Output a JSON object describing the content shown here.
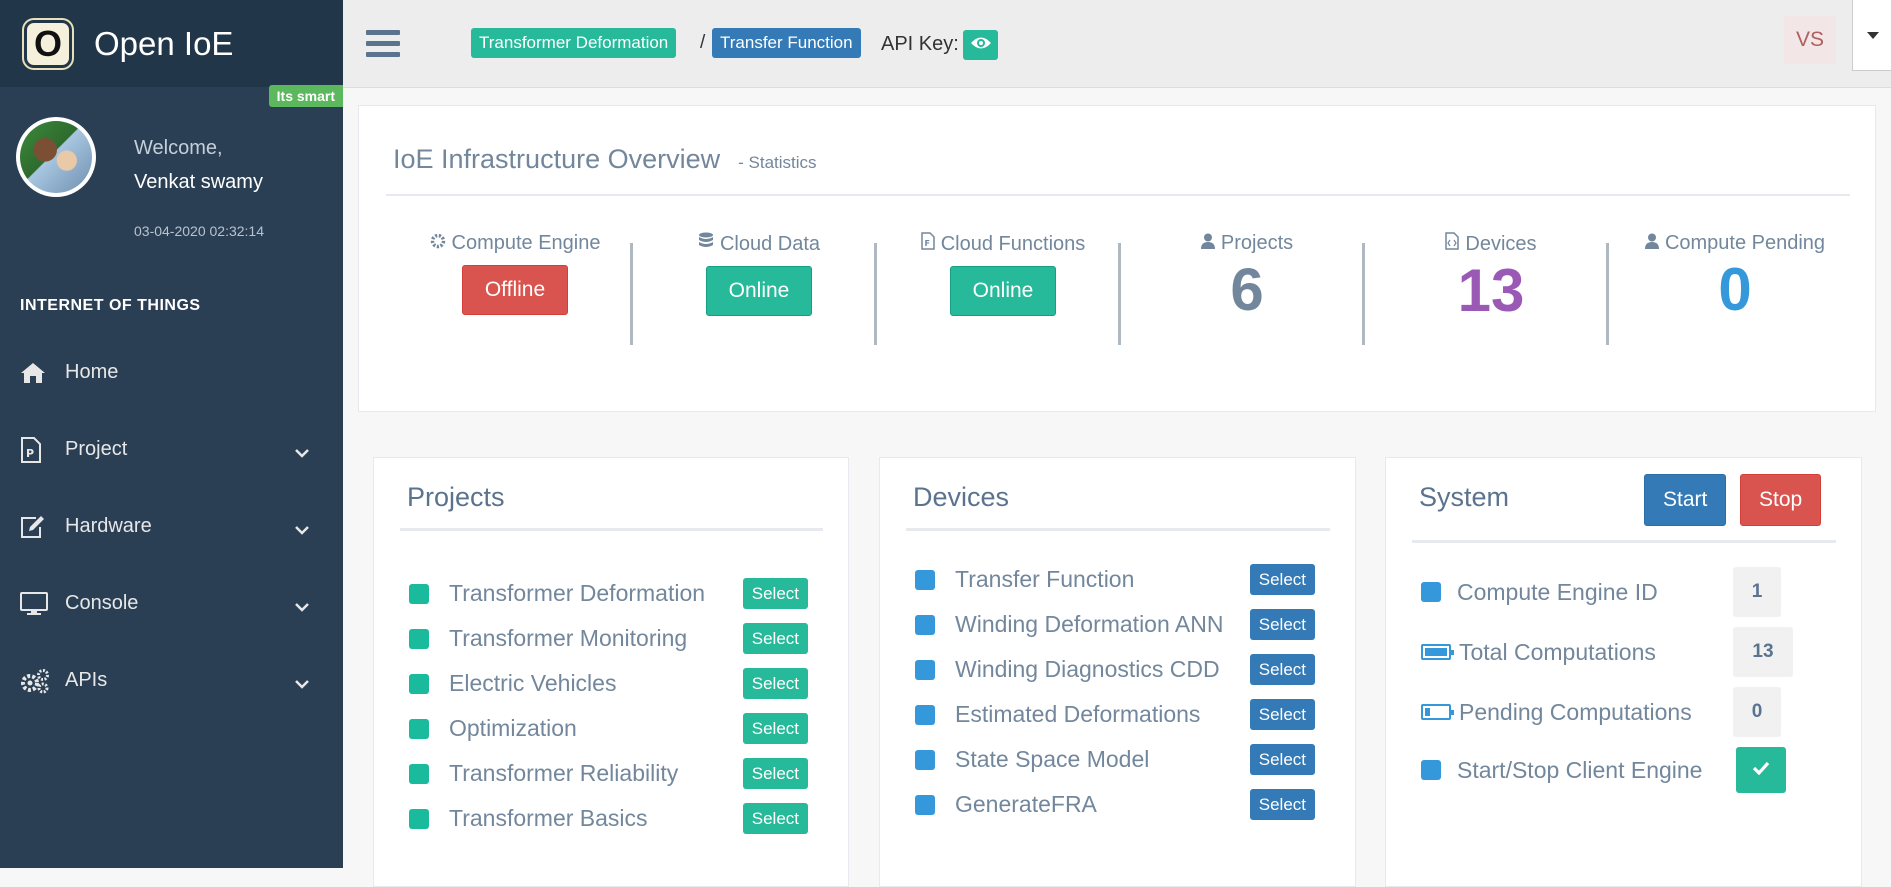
{
  "sidebar": {
    "brand_logo": "O",
    "brand_name": "Open IoE",
    "badge": "Its smart",
    "welcome": "Welcome,",
    "username": "Venkat swamy",
    "timestamp": "03-04-2020 02:32:14",
    "section_title": "INTERNET OF THINGS",
    "items": [
      {
        "label": "Home",
        "icon": "home-icon"
      },
      {
        "label": "Project",
        "icon": "project-icon"
      },
      {
        "label": "Hardware",
        "icon": "edit-icon"
      },
      {
        "label": "Console",
        "icon": "monitor-icon"
      },
      {
        "label": "APIs",
        "icon": "gears-icon"
      }
    ]
  },
  "topnav": {
    "breadcrumb": [
      "Transformer Deformation",
      "Transfer Function"
    ],
    "separator": "/",
    "api_key_label": "API Key:",
    "user_initials": "VS"
  },
  "overview": {
    "title": "IoE Infrastructure Overview",
    "subtitle": "- Statistics",
    "stats": [
      {
        "label": "Compute Engine",
        "status": "Offline",
        "icon": "gear-icon"
      },
      {
        "label": "Cloud Data",
        "status": "Online",
        "icon": "database-icon"
      },
      {
        "label": "Cloud Functions",
        "status": "Online",
        "icon": "file-code-icon"
      },
      {
        "label": "Projects",
        "value": "6",
        "icon": "user-icon"
      },
      {
        "label": "Devices",
        "value": "13",
        "icon": "file-code-icon"
      },
      {
        "label": "Compute Pending",
        "value": "0",
        "icon": "user-icon"
      }
    ]
  },
  "projects": {
    "title": "Projects",
    "select_label": "Select",
    "items": [
      "Transformer Deformation",
      "Transformer Monitoring",
      "Electric Vehicles",
      "Optimization",
      "Transformer Reliability",
      "Transformer Basics"
    ]
  },
  "devices": {
    "title": "Devices",
    "select_label": "Select",
    "items": [
      "Transfer Function",
      "Winding Deformation ANN",
      "Winding Diagnostics CDD",
      "Estimated Deformations",
      "State Space Model",
      "GenerateFRA"
    ]
  },
  "system": {
    "title": "System",
    "start_label": "Start",
    "stop_label": "Stop",
    "rows": [
      {
        "label": "Compute Engine ID",
        "value": "1"
      },
      {
        "label": "Total Computations",
        "value": "13"
      },
      {
        "label": "Pending Computations",
        "value": "0"
      },
      {
        "label": "Start/Stop Client Engine"
      }
    ]
  },
  "colors": {
    "sidebar": "#2a3f54",
    "green": "#26b99a",
    "blue": "#337ab7",
    "red": "#d9534f",
    "purple": "#9b59b6",
    "light_blue": "#3498db",
    "slate": "#73879c"
  }
}
